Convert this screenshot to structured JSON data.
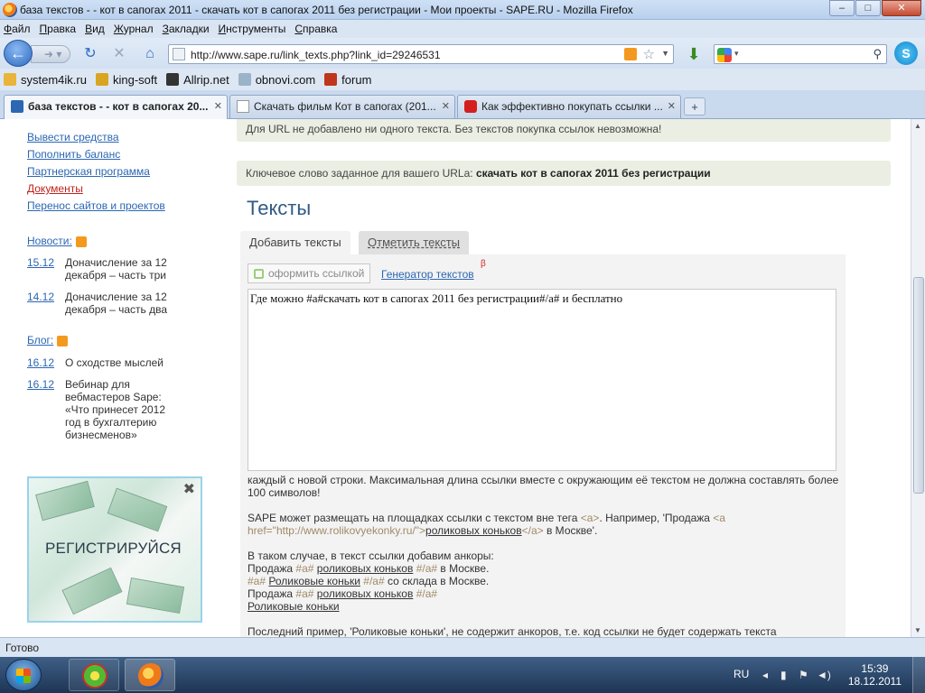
{
  "window": {
    "title": "база текстов - - кот в сапогах 2011 - скачать кот в сапогах 2011 без регистрации - Мои проекты - SAPE.RU - Mozilla Firefox",
    "buttons": {
      "minimize": "–",
      "maximize": "□",
      "close": "✕"
    }
  },
  "menu": [
    "Файл",
    "Правка",
    "Вид",
    "Журнал",
    "Закладки",
    "Инструменты",
    "Справка"
  ],
  "nav": {
    "url": "http://www.sape.ru/link_texts.php?link_id=29246531",
    "search_placeholder": ""
  },
  "bookmarks": [
    {
      "label": "system4ik.ru",
      "color": "#e8b43a"
    },
    {
      "label": "king-soft",
      "color": "#d9a520"
    },
    {
      "label": "Allrip.net",
      "color": "#333333"
    },
    {
      "label": "obnovi.com",
      "color": "#9ab3c8"
    },
    {
      "label": "forum",
      "color": "#c0361c"
    }
  ],
  "tabs": [
    {
      "label": "база текстов - - кот в сапогах 20...",
      "active": true
    },
    {
      "label": "Скачать фильм Кот в сапогах (201...",
      "active": false
    },
    {
      "label": "Как эффективно покупать ссылки ...",
      "active": false
    }
  ],
  "sidebar": {
    "links": [
      "Вывести средства",
      "Пополнить баланс",
      "Партнерская программа",
      "Документы",
      "Перенос сайтов и проектов"
    ],
    "news_label": "Новости:",
    "news": [
      {
        "date": "15.12",
        "text": "Доначисление за 12 декабря – часть три"
      },
      {
        "date": "14.12",
        "text": "Доначисление за 12 декабря – часть два"
      }
    ],
    "blog_label": "Блог:",
    "blog": [
      {
        "date": "16.12",
        "text": "О сходстве мыслей"
      },
      {
        "date": "16.12",
        "text": "Вебинар для вебмастеров Sape: «Что принесет 2012 год в бухгалтерию бизнесменов»"
      }
    ],
    "ad": {
      "text": "РЕГИСТРИРУЙСЯ",
      "vertical": "advaction"
    }
  },
  "main": {
    "note1": "Для URL не добавлено ни одного текста. Без текстов покупка ссылок невозможна!",
    "note2_prefix": "Ключевое слово заданное для вашего URLa: ",
    "note2_keyword": "скачать кот в сапогах 2011 без регистрации",
    "heading": "Тексты",
    "tab_add": "Добавить тексты",
    "tab_mark": "Отметить тексты",
    "format_button": "оформить ссылкой",
    "generator_link": "Генератор текстов",
    "beta": "β",
    "textarea_value": "Где можно #a#скачать кот в сапогах 2011 без регистрации#/a# и бесплатно",
    "help1": "каждый с новой строки. Максимальная длина ссылки вместе с окружающим её текстом не должна составлять более 100 символов!",
    "help2_a": "SAPE может размещать на площадках ссылки с текстом вне тега ",
    "help2_tag": "<a>",
    "help2_b": ". Например, 'Продажа ",
    "help2_href": "<a href=\"http://www.rolikovyekonky.ru/\">",
    "help2_anchor": "роликовых коньков",
    "help2_close": "</a>",
    "help2_c": " в Москве'.",
    "help3": "В таком случае, в текст ссылки добавим анкоры:",
    "ex1_a": "Продажа ",
    "ex1_t1": "#a#",
    "ex1_anchor": "роликовых коньков",
    "ex1_t2": "#/a#",
    "ex1_b": " в Москве.",
    "ex2_t1": "#a#",
    "ex2_anchor": "Роликовые коньки",
    "ex2_t2": "#/a#",
    "ex2_b": " со склада в Москве.",
    "ex3_a": "Продажа ",
    "ex3_t1": "#a#",
    "ex3_anchor": "роликовых коньков",
    "ex3_t2": "#/a#",
    "ex4": "Роликовые коньки",
    "help4": "Последний пример, 'Роликовые коньки', не содержит анкоров, т.е. код ссылки не будет содержать текста"
  },
  "status": "Готово",
  "taskbar": {
    "lang": "RU",
    "time": "15:39",
    "date": "18.12.2011"
  }
}
